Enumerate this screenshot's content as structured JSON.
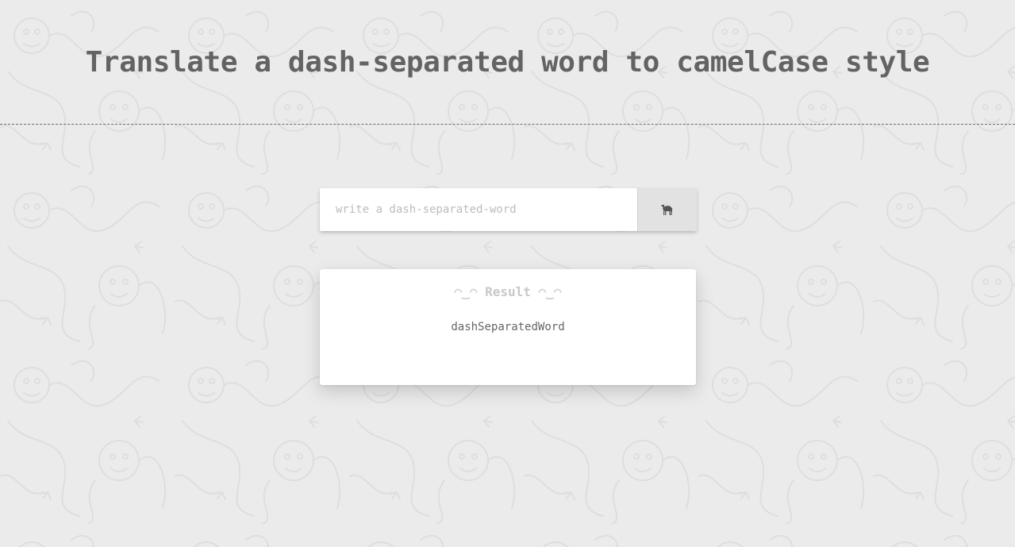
{
  "header": {
    "title": "Translate a dash-separated word to camelCase style"
  },
  "form": {
    "input_value": "",
    "input_placeholder": "write a dash-separated-word",
    "submit_icon": "camel-icon"
  },
  "result": {
    "face_left": "◠‿◠",
    "label": "Result",
    "face_right": "◠‿◠",
    "value": "dashSeparatedWord"
  },
  "colors": {
    "background": "#ebebeb",
    "title_text": "#636363",
    "placeholder_text": "#bcbcbc",
    "result_heading": "#c8c8c8",
    "button_bg": "#e2e2e2",
    "icon": "#555555"
  }
}
